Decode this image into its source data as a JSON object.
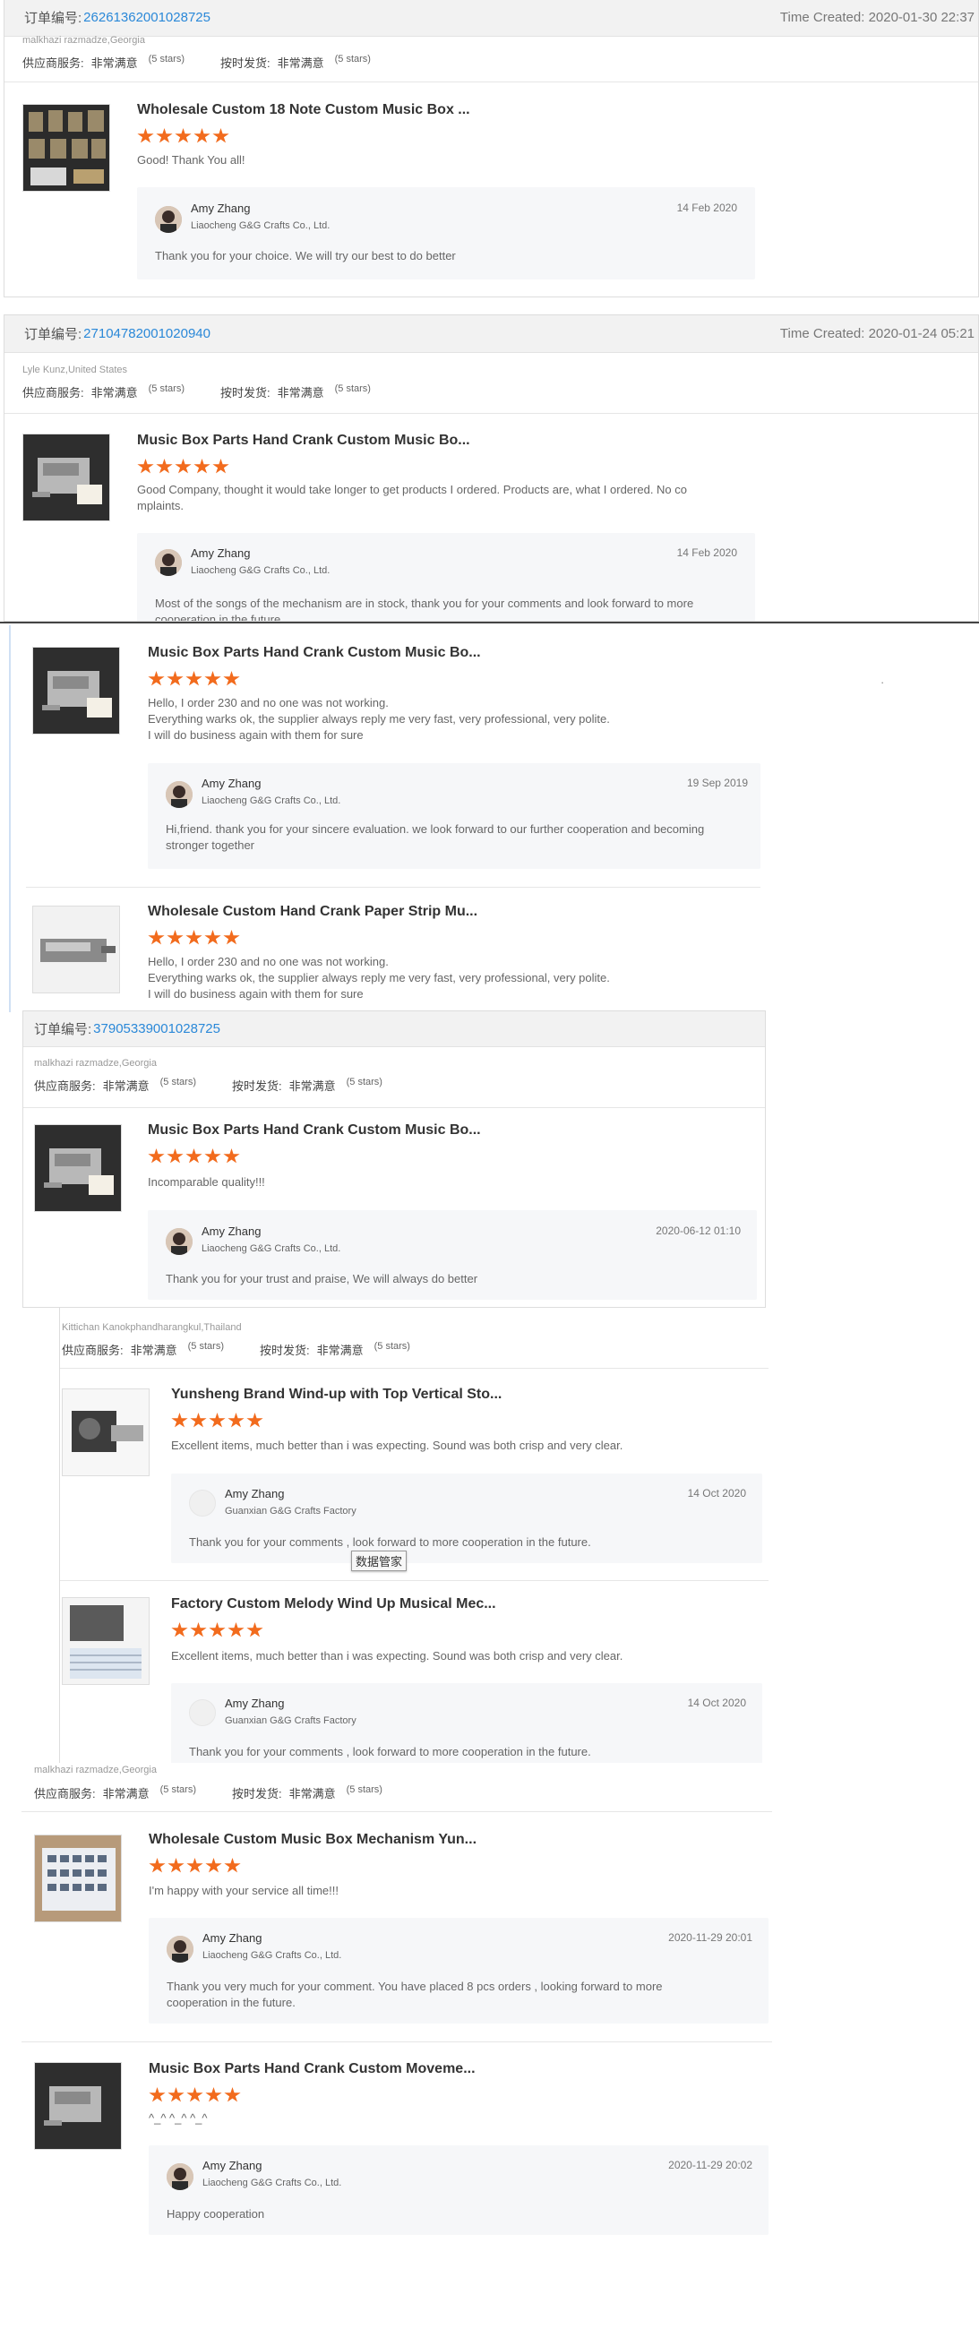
{
  "rating_labels": {
    "supplier_service": "供应商服务:",
    "on_time": "按时发货:",
    "very_satisfied": "非常满意",
    "five_stars": "(5 stars)"
  },
  "order_label": "订单编号:",
  "tooltip": "数据管家",
  "dot": "·",
  "orders": [
    {
      "order_no": "26261362001028725",
      "time": "Time Created: 2020-01-30 22:37",
      "buyer": "malkhazi razmadze,Georgia",
      "items": [
        {
          "title": "Wholesale Custom 18 Note Custom Music Box ...",
          "stars": 5,
          "comment": [
            "Good! Thank You all!"
          ],
          "reply": {
            "name": "Amy Zhang",
            "company": "Liaocheng G&G Crafts Co., Ltd.",
            "date": "14 Feb 2020",
            "text": [
              "Thank you for your choice. We will try our best to do better"
            ]
          }
        }
      ]
    },
    {
      "order_no": "27104782001020940",
      "time": "Time Created: 2020-01-24 05:21",
      "buyer": "Lyle Kunz,United States",
      "items": [
        {
          "title": "Music Box Parts Hand Crank Custom Music Bo...",
          "stars": 5,
          "comment": [
            "Good Company, thought it would take longer to get products I ordered. Products are, what I ordered. No co",
            "mplaints."
          ],
          "reply": {
            "name": "Amy Zhang",
            "company": "Liaocheng G&G Crafts Co., Ltd.",
            "date": "14 Feb 2020",
            "text": [
              "Most of the songs of the mechanism are in stock, thank you for your comments and look forward to more",
              "cooperation in the future"
            ]
          }
        }
      ]
    },
    {
      "items": [
        {
          "title": "Music Box Parts Hand Crank Custom Music Bo...",
          "stars": 5,
          "comment": [
            "Hello, I order 230 and no one was not working.",
            "Everything warks ok, the supplier always reply me very fast, very professional, very polite.",
            "I will do business again with them for sure"
          ],
          "reply": {
            "name": "Amy Zhang",
            "company": "Liaocheng G&G Crafts Co., Ltd.",
            "date": "19 Sep 2019",
            "text": [
              "Hi,friend. thank you for your sincere evaluation. we look forward to our further cooperation and becoming",
              "stronger together"
            ]
          }
        },
        {
          "title": "Wholesale Custom Hand Crank Paper Strip Mu...",
          "stars": 5,
          "comment": [
            "Hello, I order 230 and no one was not working.",
            "Everything warks ok, the supplier always reply me very fast, very professional, very polite.",
            "I will do business again with them for sure"
          ]
        }
      ]
    },
    {
      "order_no": "37905339001028725",
      "buyer": "malkhazi razmadze,Georgia",
      "items": [
        {
          "title": "Music Box Parts Hand Crank Custom Music Bo...",
          "stars": 5,
          "comment": [
            "Incomparable quality!!!"
          ],
          "reply": {
            "name": "Amy Zhang",
            "company": "Liaocheng G&G Crafts Co., Ltd.",
            "date": "2020-06-12 01:10",
            "text": [
              "Thank you for your trust and praise, We will always do better"
            ]
          }
        }
      ]
    },
    {
      "buyer": "Kittichan Kanokphandharangkul,Thailand",
      "items": [
        {
          "title": "Yunsheng Brand Wind-up with Top Vertical Sto...",
          "stars": 5,
          "comment": [
            "Excellent items, much better than i was expecting. Sound was both crisp and very clear."
          ],
          "reply": {
            "name": "Amy Zhang",
            "company": "Guanxian G&G Crafts Factory",
            "date": "14 Oct 2020",
            "text": [
              "Thank you for your comments , look forward to more cooperation in the future."
            ]
          }
        },
        {
          "title": "Factory Custom Melody Wind Up Musical Mec...",
          "stars": 5,
          "comment": [
            "Excellent items, much better than i was expecting. Sound was both crisp and very clear."
          ],
          "reply": {
            "name": "Amy Zhang",
            "company": "Guanxian G&G Crafts Factory",
            "date": "14 Oct 2020",
            "text": [
              "Thank you for your comments , look forward to more cooperation in the future."
            ]
          }
        }
      ]
    },
    {
      "buyer": "malkhazi razmadze,Georgia",
      "items": [
        {
          "title": "Wholesale Custom Music Box Mechanism Yun...",
          "stars": 5,
          "comment": [
            "I'm happy with your service all time!!!"
          ],
          "reply": {
            "name": "Amy Zhang",
            "company": "Liaocheng G&G Crafts Co., Ltd.",
            "date": "2020-11-29 20:01",
            "text": [
              "Thank you very much for your comment. You have placed 8 pcs orders , looking  forward to more",
              "cooperation in the future."
            ]
          }
        },
        {
          "title": "Music Box Parts Hand Crank Custom Moveme...",
          "stars": 5,
          "comment": [
            "^_^ ^_^ ^_^"
          ],
          "reply": {
            "name": "Amy Zhang",
            "company": "Liaocheng G&G Crafts Co., Ltd.",
            "date": "2020-11-29 20:02",
            "text": [
              "Happy cooperation"
            ]
          }
        }
      ]
    }
  ]
}
